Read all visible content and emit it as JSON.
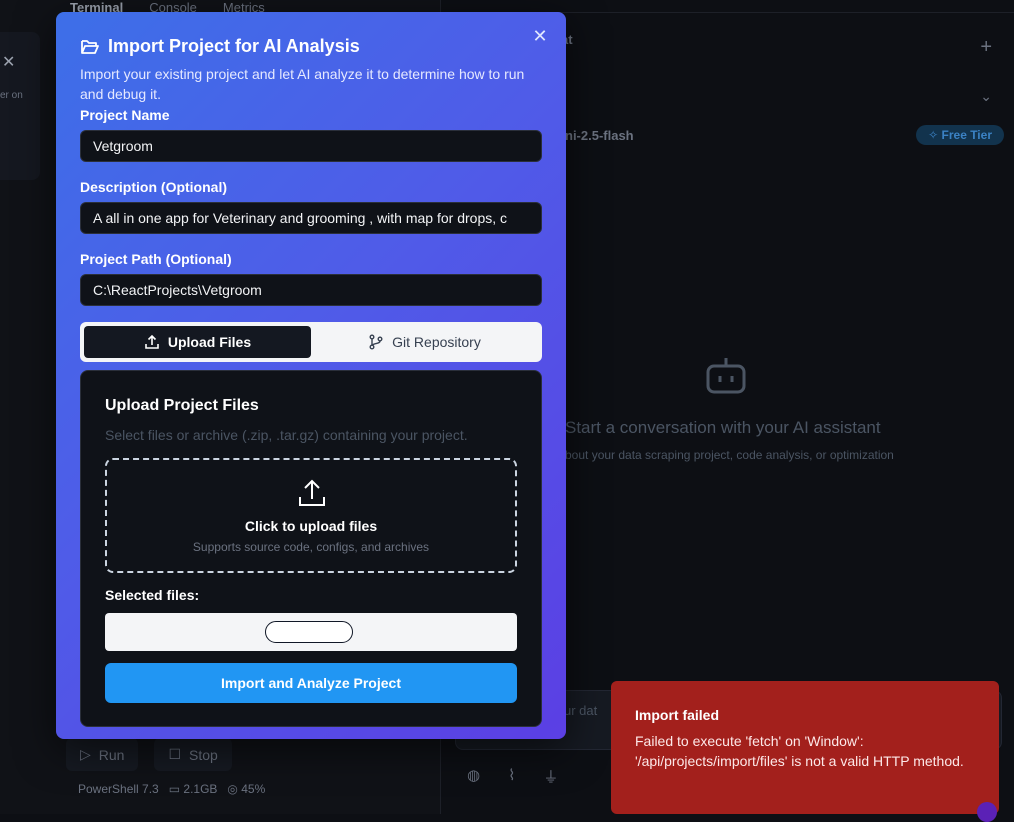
{
  "background": {
    "tabs": [
      "Terminal",
      "Console",
      "Metrics"
    ],
    "run_label": "Run",
    "stop_label": "Stop",
    "status": [
      "PowerShell 7.3",
      "2.1GB",
      "45%"
    ],
    "chat_title": "at",
    "model": "ni-2.5-flash",
    "tier_badge": "Free Tier",
    "start_title": "Start a conversation with your AI assistant",
    "start_sub": "bout your data scraping project, code analysis, or optimization",
    "input_placeholder": "ur dat",
    "left_card_text": "er on"
  },
  "modal": {
    "title": "Import Project for AI Analysis",
    "description": "Import your existing project and let AI analyze it to determine how to run and debug it.",
    "project_name_label": "Project Name",
    "project_name_value": "Vetgroom",
    "description_label": "Description (Optional)",
    "description_value": "A all in one app for Veterinary and grooming , with map for drops, c",
    "path_label": "Project Path (Optional)",
    "path_value": "C:\\ReactProjects\\Vetgroom",
    "tabs": [
      {
        "label": "Upload Files",
        "icon": "upload-icon"
      },
      {
        "label": "Git Repository",
        "icon": "git-branch-icon"
      }
    ],
    "upload": {
      "title": "Upload Project Files",
      "subtitle": "Select files or archive (.zip, .tar.gz) containing your project.",
      "dropzone_title": "Click to upload files",
      "dropzone_sub": "Supports source code, configs, and archives",
      "selected_label": "Selected files:",
      "submit_label": "Import and Analyze Project"
    }
  },
  "toast": {
    "title": "Import failed",
    "message": "Failed to execute 'fetch' on 'Window': '/api/projects/import/files' is not a valid HTTP method."
  },
  "colors": {
    "modal_gradient_start": "#3d6fe8",
    "modal_gradient_end": "#5b3fe4",
    "primary_button": "#2196f3",
    "toast_bg": "#a3201c"
  }
}
